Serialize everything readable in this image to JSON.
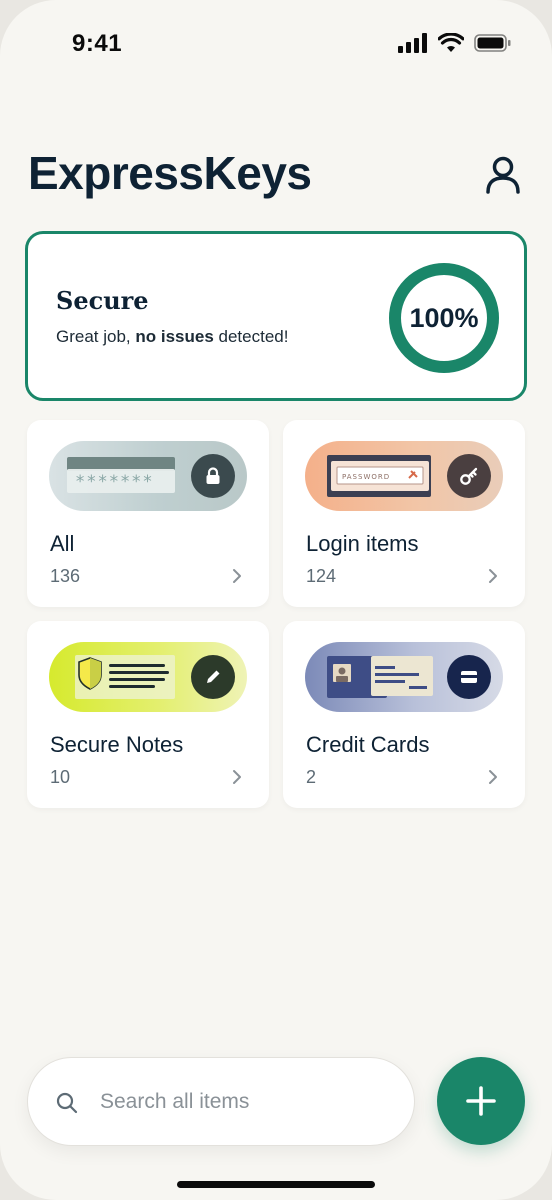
{
  "status_bar": {
    "time": "9:41"
  },
  "header": {
    "title": "ExpressKeys",
    "profile_icon": "person-icon"
  },
  "security": {
    "title": "Secure",
    "description_prefix": "Great job, ",
    "description_bold": "no issues",
    "description_suffix": " detected!",
    "score_label": "100%",
    "score_fraction": 1.0,
    "accent_color": "#1a8669"
  },
  "categories": [
    {
      "label": "All",
      "count": "136",
      "icon": "lock-icon"
    },
    {
      "label": "Login items",
      "count": "124",
      "icon": "key-icon"
    },
    {
      "label": "Secure Notes",
      "count": "10",
      "icon": "pencil-icon"
    },
    {
      "label": "Credit Cards",
      "count": "2",
      "icon": "card-icon"
    }
  ],
  "login_art": {
    "field_text": "PASSWORD"
  },
  "all_art": {
    "field_text": "*******"
  },
  "search": {
    "placeholder": "Search all items",
    "value": ""
  },
  "fab": {
    "icon": "plus-icon"
  }
}
